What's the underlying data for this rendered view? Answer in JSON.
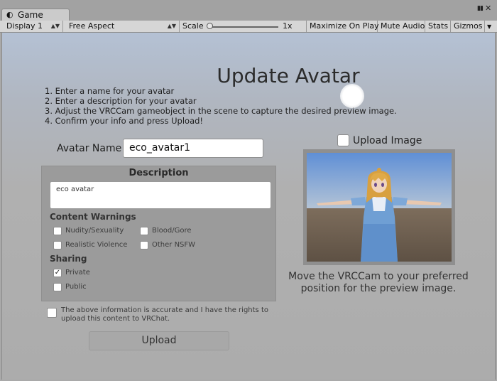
{
  "tab": {
    "title": "Game",
    "icon": "unity-game-icon"
  },
  "window_controls": {
    "menu_glyph": "▮▮",
    "close_glyph": "✕"
  },
  "toolbar": {
    "display": "Display 1",
    "aspect": "Free Aspect",
    "scale_label": "Scale",
    "scale_value": "1x",
    "maximize_on_play": "Maximize On Play",
    "mute_audio": "Mute Audio",
    "stats": "Stats",
    "gizmos": "Gizmos"
  },
  "form": {
    "title": "Update Avatar",
    "instructions": [
      "1. Enter a name for your avatar",
      "2. Enter a description for your avatar",
      "3. Adjust the VRCCam gameobject in the scene to capture the desired preview image.",
      "4. Confirm your info and press Upload!"
    ],
    "name_label": "Avatar Name",
    "name_value": "eco_avatar1",
    "description_title": "Description",
    "description_value": "eco avatar",
    "content_warnings_title": "Content Warnings",
    "warnings": [
      {
        "label": "Nudity/Sexuality",
        "checked": false
      },
      {
        "label": "Blood/Gore",
        "checked": false
      },
      {
        "label": "Realistic Violence",
        "checked": false
      },
      {
        "label": "Other NSFW",
        "checked": false
      }
    ],
    "sharing_title": "Sharing",
    "sharing": [
      {
        "label": "Private",
        "checked": true
      },
      {
        "label": "Public",
        "checked": false
      }
    ],
    "accurate_line1": "The above information is accurate and I have the rights to",
    "accurate_line2": "upload this content to VRChat.",
    "accurate_checked": false,
    "upload_button": "Upload",
    "upload_image_label": "Upload Image",
    "upload_image_checked": false,
    "preview_caption_line1": "Move the VRCCam to your preferred",
    "preview_caption_line2": "position for the preview image."
  },
  "colors": {
    "background": "#acacac",
    "panel": "#9b9b9b",
    "sky": "#6f9ad8",
    "ground": "#6b5c4c"
  }
}
